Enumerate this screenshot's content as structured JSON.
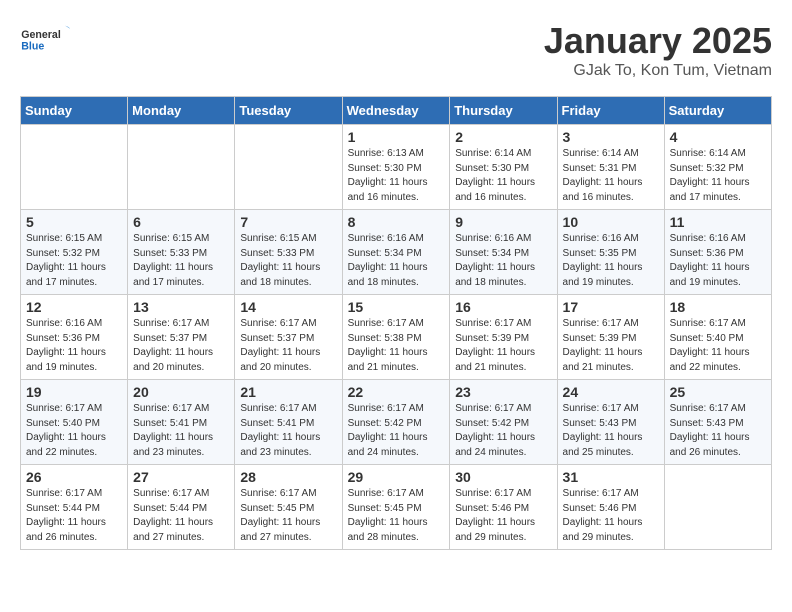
{
  "header": {
    "logo_general": "General",
    "logo_blue": "Blue",
    "month": "January 2025",
    "location": "GJak To, Kon Tum, Vietnam"
  },
  "weekdays": [
    "Sunday",
    "Monday",
    "Tuesday",
    "Wednesday",
    "Thursday",
    "Friday",
    "Saturday"
  ],
  "weeks": [
    [
      {
        "day": "",
        "info": ""
      },
      {
        "day": "",
        "info": ""
      },
      {
        "day": "",
        "info": ""
      },
      {
        "day": "1",
        "info": "Sunrise: 6:13 AM\nSunset: 5:30 PM\nDaylight: 11 hours and 16 minutes."
      },
      {
        "day": "2",
        "info": "Sunrise: 6:14 AM\nSunset: 5:30 PM\nDaylight: 11 hours and 16 minutes."
      },
      {
        "day": "3",
        "info": "Sunrise: 6:14 AM\nSunset: 5:31 PM\nDaylight: 11 hours and 16 minutes."
      },
      {
        "day": "4",
        "info": "Sunrise: 6:14 AM\nSunset: 5:32 PM\nDaylight: 11 hours and 17 minutes."
      }
    ],
    [
      {
        "day": "5",
        "info": "Sunrise: 6:15 AM\nSunset: 5:32 PM\nDaylight: 11 hours and 17 minutes."
      },
      {
        "day": "6",
        "info": "Sunrise: 6:15 AM\nSunset: 5:33 PM\nDaylight: 11 hours and 17 minutes."
      },
      {
        "day": "7",
        "info": "Sunrise: 6:15 AM\nSunset: 5:33 PM\nDaylight: 11 hours and 18 minutes."
      },
      {
        "day": "8",
        "info": "Sunrise: 6:16 AM\nSunset: 5:34 PM\nDaylight: 11 hours and 18 minutes."
      },
      {
        "day": "9",
        "info": "Sunrise: 6:16 AM\nSunset: 5:34 PM\nDaylight: 11 hours and 18 minutes."
      },
      {
        "day": "10",
        "info": "Sunrise: 6:16 AM\nSunset: 5:35 PM\nDaylight: 11 hours and 19 minutes."
      },
      {
        "day": "11",
        "info": "Sunrise: 6:16 AM\nSunset: 5:36 PM\nDaylight: 11 hours and 19 minutes."
      }
    ],
    [
      {
        "day": "12",
        "info": "Sunrise: 6:16 AM\nSunset: 5:36 PM\nDaylight: 11 hours and 19 minutes."
      },
      {
        "day": "13",
        "info": "Sunrise: 6:17 AM\nSunset: 5:37 PM\nDaylight: 11 hours and 20 minutes."
      },
      {
        "day": "14",
        "info": "Sunrise: 6:17 AM\nSunset: 5:37 PM\nDaylight: 11 hours and 20 minutes."
      },
      {
        "day": "15",
        "info": "Sunrise: 6:17 AM\nSunset: 5:38 PM\nDaylight: 11 hours and 21 minutes."
      },
      {
        "day": "16",
        "info": "Sunrise: 6:17 AM\nSunset: 5:39 PM\nDaylight: 11 hours and 21 minutes."
      },
      {
        "day": "17",
        "info": "Sunrise: 6:17 AM\nSunset: 5:39 PM\nDaylight: 11 hours and 21 minutes."
      },
      {
        "day": "18",
        "info": "Sunrise: 6:17 AM\nSunset: 5:40 PM\nDaylight: 11 hours and 22 minutes."
      }
    ],
    [
      {
        "day": "19",
        "info": "Sunrise: 6:17 AM\nSunset: 5:40 PM\nDaylight: 11 hours and 22 minutes."
      },
      {
        "day": "20",
        "info": "Sunrise: 6:17 AM\nSunset: 5:41 PM\nDaylight: 11 hours and 23 minutes."
      },
      {
        "day": "21",
        "info": "Sunrise: 6:17 AM\nSunset: 5:41 PM\nDaylight: 11 hours and 23 minutes."
      },
      {
        "day": "22",
        "info": "Sunrise: 6:17 AM\nSunset: 5:42 PM\nDaylight: 11 hours and 24 minutes."
      },
      {
        "day": "23",
        "info": "Sunrise: 6:17 AM\nSunset: 5:42 PM\nDaylight: 11 hours and 24 minutes."
      },
      {
        "day": "24",
        "info": "Sunrise: 6:17 AM\nSunset: 5:43 PM\nDaylight: 11 hours and 25 minutes."
      },
      {
        "day": "25",
        "info": "Sunrise: 6:17 AM\nSunset: 5:43 PM\nDaylight: 11 hours and 26 minutes."
      }
    ],
    [
      {
        "day": "26",
        "info": "Sunrise: 6:17 AM\nSunset: 5:44 PM\nDaylight: 11 hours and 26 minutes."
      },
      {
        "day": "27",
        "info": "Sunrise: 6:17 AM\nSunset: 5:44 PM\nDaylight: 11 hours and 27 minutes."
      },
      {
        "day": "28",
        "info": "Sunrise: 6:17 AM\nSunset: 5:45 PM\nDaylight: 11 hours and 27 minutes."
      },
      {
        "day": "29",
        "info": "Sunrise: 6:17 AM\nSunset: 5:45 PM\nDaylight: 11 hours and 28 minutes."
      },
      {
        "day": "30",
        "info": "Sunrise: 6:17 AM\nSunset: 5:46 PM\nDaylight: 11 hours and 29 minutes."
      },
      {
        "day": "31",
        "info": "Sunrise: 6:17 AM\nSunset: 5:46 PM\nDaylight: 11 hours and 29 minutes."
      },
      {
        "day": "",
        "info": ""
      }
    ]
  ]
}
